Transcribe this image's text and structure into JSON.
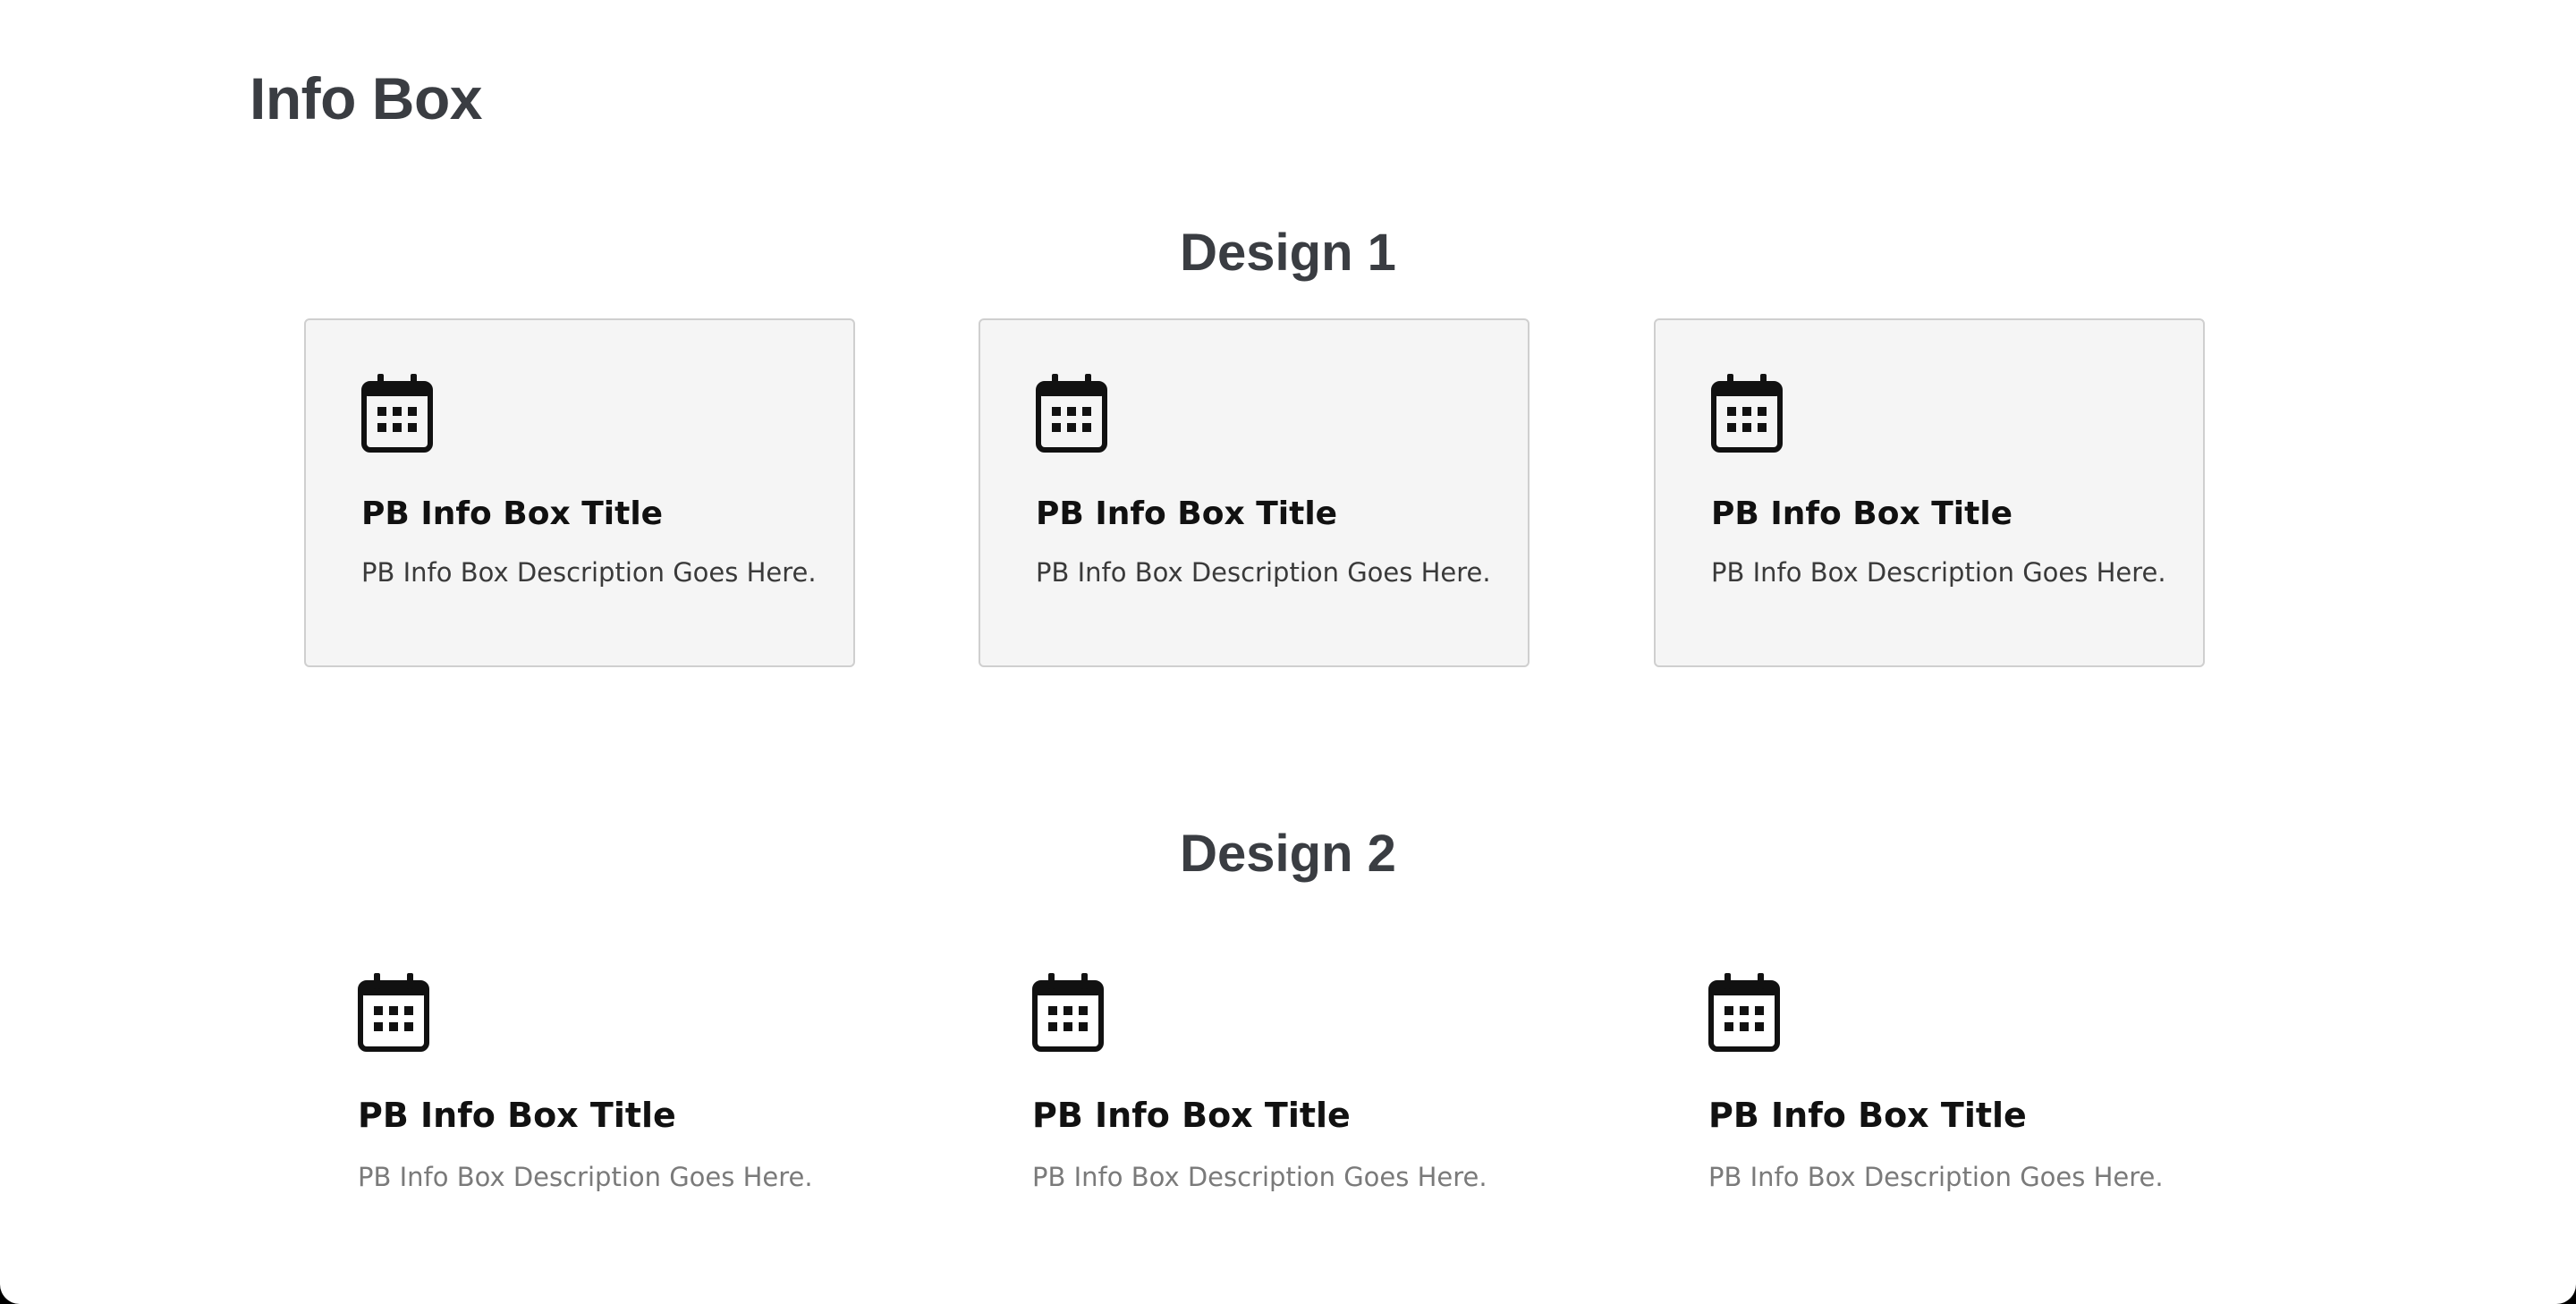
{
  "page": {
    "title": "Info Box"
  },
  "sections": [
    {
      "title": "Design 1",
      "boxes": [
        {
          "icon": "calendar-icon",
          "title": "PB Info Box Title",
          "description": "PB Info Box Description Goes Here."
        },
        {
          "icon": "calendar-icon",
          "title": "PB Info Box Title",
          "description": "PB Info Box Description Goes Here."
        },
        {
          "icon": "calendar-icon",
          "title": "PB Info Box Title",
          "description": "PB Info Box Description Goes Here."
        }
      ]
    },
    {
      "title": "Design 2",
      "boxes": [
        {
          "icon": "calendar-icon",
          "title": "PB Info Box Title",
          "description": "PB Info Box Description Goes Here."
        },
        {
          "icon": "calendar-icon",
          "title": "PB Info Box Title",
          "description": "PB Info Box Description Goes Here."
        },
        {
          "icon": "calendar-icon",
          "title": "PB Info Box Title",
          "description": "PB Info Box Description Goes Here."
        }
      ]
    }
  ],
  "colors": {
    "heading": "#3a3d42",
    "box_background": "#f5f5f5",
    "box_border": "#cfcfcf",
    "description_design2": "#7a7a7a"
  }
}
